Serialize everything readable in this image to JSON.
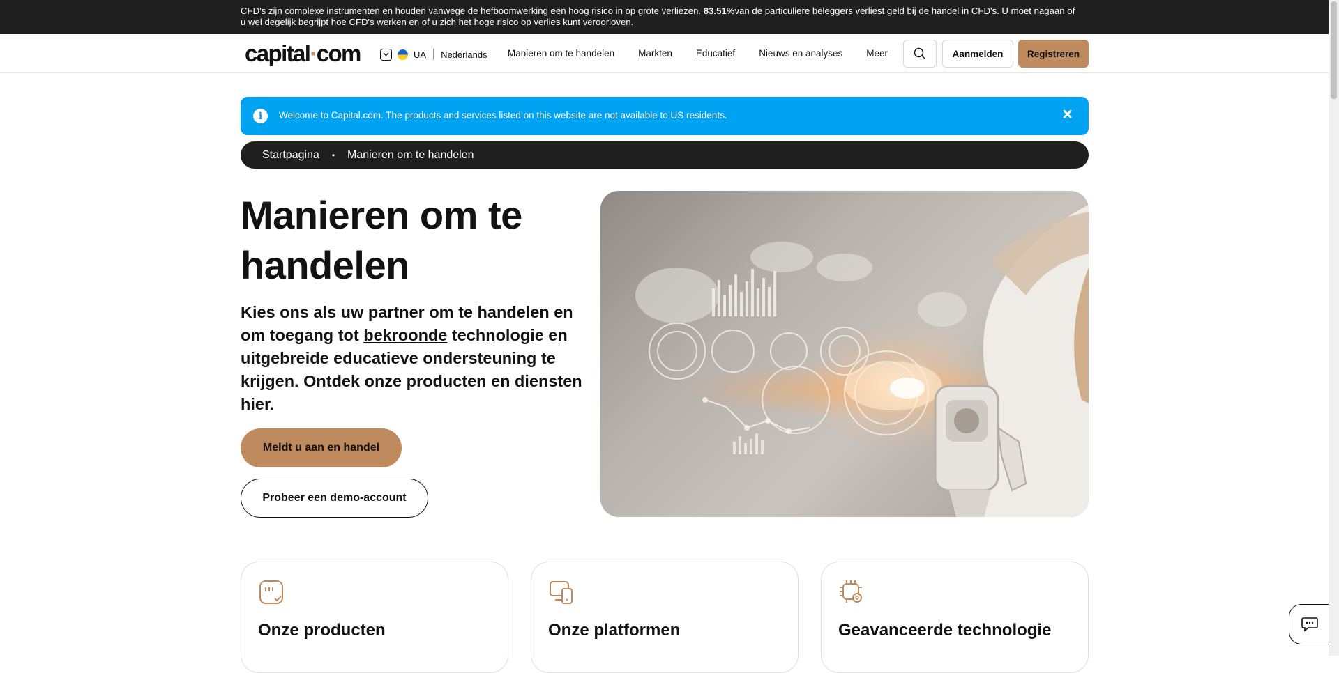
{
  "risk_warning": {
    "text_before": "CFD's zijn complexe instrumenten en houden vanwege de hefboomwerking een hoog risico in op grote verliezen. ",
    "percentage": "83.51%",
    "text_after": "van de particuliere beleggers verliest geld bij de handel in CFD's. U moet nagaan of u wel degelijk begrijpt hoe CFD's werken en of u zich het hoge risico op verlies kunt veroorloven."
  },
  "header": {
    "logo_text_1": "capital",
    "logo_dot": "·",
    "logo_text_2": "com",
    "region": "UA",
    "language": "Nederlands",
    "nav": [
      "Manieren om te handelen",
      "Markten",
      "Educatief",
      "Nieuws en analyses",
      "Meer"
    ],
    "login_label": "Aanmelden",
    "register_label": "Registreren"
  },
  "notice": {
    "icon": "info-icon",
    "message": "Welcome to Capital.com. The products and services listed on this website are not available to US residents.",
    "close": "✕"
  },
  "breadcrumb": {
    "items": [
      "Startpagina",
      "Manieren om te handelen"
    ],
    "separator": "•"
  },
  "hero": {
    "title": "Manieren om te handelen",
    "subtitle_1": "Kies ons als uw partner om te handelen en om toegang tot ",
    "subtitle_link": "bekroonde",
    "subtitle_2": " technologie en uitgebreide educatieve ondersteuning te krijgen. Ontdek onze producten en diensten hier.",
    "cta_primary": "Meldt u aan en handel",
    "cta_secondary": "Probeer een demo-account"
  },
  "cards": [
    {
      "icon": "products-icon",
      "title": "Onze producten"
    },
    {
      "icon": "platforms-icon",
      "title": "Onze platformen"
    },
    {
      "icon": "technology-icon",
      "title": "Geavanceerde technologie"
    }
  ],
  "colors": {
    "accent": "#bf8a5d",
    "dark": "#1f1f1f",
    "notice_blue": "#00a2f2"
  },
  "chat_icon": "chat-icon"
}
